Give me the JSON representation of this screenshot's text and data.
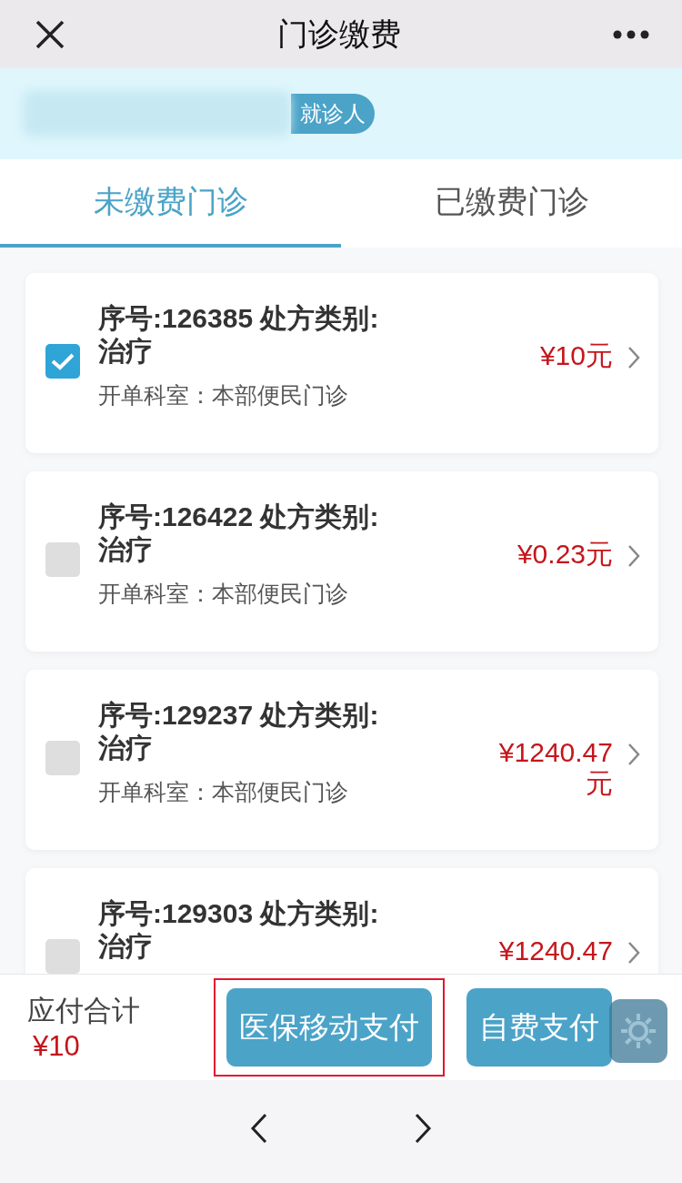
{
  "header": {
    "title": "门诊缴费"
  },
  "patient": {
    "badge": "就诊人"
  },
  "tabs": [
    {
      "label": "未缴费门诊",
      "selected": true
    },
    {
      "label": "已缴费门诊",
      "selected": false
    }
  ],
  "orders": [
    {
      "title": "序号:126385 处方类别:治疗",
      "department": "开单科室：本部便民门诊",
      "price": "¥10元",
      "checked": true
    },
    {
      "title": "序号:126422 处方类别:治疗",
      "department": "开单科室：本部便民门诊",
      "price": "¥0.23元",
      "checked": false
    },
    {
      "title": "序号:129237 处方类别:治疗",
      "department": "开单科室：本部便民门诊",
      "price": "¥1240.47元",
      "checked": false
    },
    {
      "title": "序号:129303 处方类别:治疗",
      "price": "¥1240.47",
      "checked": false
    }
  ],
  "footer": {
    "total_label": "应付合计",
    "total": "¥10",
    "buttons": [
      {
        "label": "医保移动支付",
        "highlighted": true
      },
      {
        "label": "自费支付",
        "highlighted": false
      }
    ]
  }
}
